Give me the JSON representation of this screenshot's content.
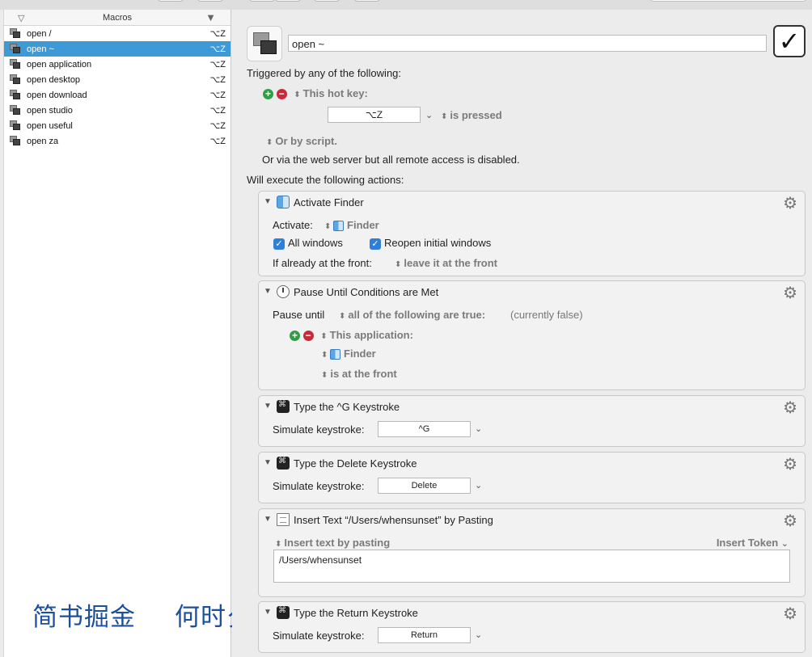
{
  "sidebar": {
    "header": "Macros",
    "items": [
      {
        "name": "open /",
        "key": "⌥Z"
      },
      {
        "name": "open ~",
        "key": "⌥Z",
        "selected": true
      },
      {
        "name": "open application",
        "key": "⌥Z"
      },
      {
        "name": "open desktop",
        "key": "⌥Z"
      },
      {
        "name": "open download",
        "key": "⌥Z"
      },
      {
        "name": "open studio",
        "key": "⌥Z"
      },
      {
        "name": "open useful",
        "key": "⌥Z"
      },
      {
        "name": "open za",
        "key": "⌥Z"
      }
    ]
  },
  "watermark": {
    "left": "简书掘金",
    "right": "何时夕"
  },
  "editor": {
    "macro_name": "open ~",
    "enabled_mark": "✓",
    "triggered_by": "Triggered by any of the following:",
    "trigger_type": "This hot key:",
    "hot_key": "⌥Z",
    "is_pressed": "is pressed",
    "or_by_script": "Or by script.",
    "web_server_note": "Or via the web server but all remote access is disabled.",
    "will_execute": "Will execute the following actions:"
  },
  "actions": {
    "activate": {
      "title": "Activate Finder",
      "activate_label": "Activate:",
      "app": "Finder",
      "all_windows": "All windows",
      "reopen": "Reopen initial windows",
      "if_front_label": "If already at the front:",
      "if_front_value": "leave it at the front"
    },
    "pause": {
      "title": "Pause Until Conditions are Met",
      "pause_until": "Pause until",
      "condition": "all of the following are true:",
      "status": "(currently false)",
      "this_app": "This application:",
      "app": "Finder",
      "state": "is at the front"
    },
    "type_g": {
      "title": "Type the ^G Keystroke",
      "label": "Simulate keystroke:",
      "key": "^G"
    },
    "type_delete": {
      "title": "Type the Delete Keystroke",
      "label": "Simulate keystroke:",
      "key": "Delete"
    },
    "insert_text": {
      "title": "Insert Text “/Users/whensunset” by Pasting",
      "mode": "Insert text by pasting",
      "insert_token": "Insert Token",
      "text": "/Users/whensunset"
    },
    "type_return": {
      "title": "Type the Return Keystroke",
      "label": "Simulate keystroke:",
      "key": "Return"
    }
  }
}
